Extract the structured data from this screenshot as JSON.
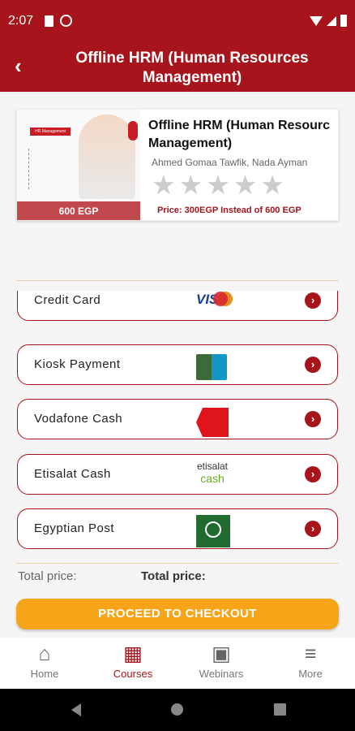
{
  "status": {
    "time": "2:07"
  },
  "header": {
    "title": "Offline HRM (Human Resources Management)"
  },
  "course": {
    "title_line1": "Offline HRM (Human Resourc",
    "title_line2": "Management)",
    "authors": "Ahmed Gomaa Tawfik, Nada Ayman",
    "rating": 0,
    "max_rating": 5,
    "thumbnail_price": "600 EGP",
    "thumbnail_label": "HR Management",
    "price_line": "Price: 300EGP Instead of 600 EGP"
  },
  "payment_methods": [
    {
      "label": "Credit Card",
      "logo": "visa-mastercard-icon"
    },
    {
      "label": "Kiosk Payment",
      "logo": "kiosk-payment-icon"
    },
    {
      "label": "Vodafone Cash",
      "logo": "vodafone-cash-icon"
    },
    {
      "label": "Etisalat Cash",
      "logo": "etisalat-cash-icon",
      "logo_text": "etisalat",
      "logo_text2": "cash"
    },
    {
      "label": "Egyptian Post",
      "logo": "egyptian-post-icon"
    }
  ],
  "totals": {
    "left_label": "Total price:",
    "right_label": "Total price:"
  },
  "checkout": {
    "label": "PROCEED TO CHECKOUT"
  },
  "bottom_nav": [
    {
      "label": "Home",
      "icon": "home-icon",
      "active": false
    },
    {
      "label": "Courses",
      "icon": "courses-icon",
      "active": true
    },
    {
      "label": "Webinars",
      "icon": "webinars-icon",
      "active": false
    },
    {
      "label": "More",
      "icon": "menu-icon",
      "active": false
    }
  ],
  "colors": {
    "brand_red": "#a7141b",
    "checkout_orange": "#f7a419",
    "divider_gold": "#ebcfa5"
  }
}
